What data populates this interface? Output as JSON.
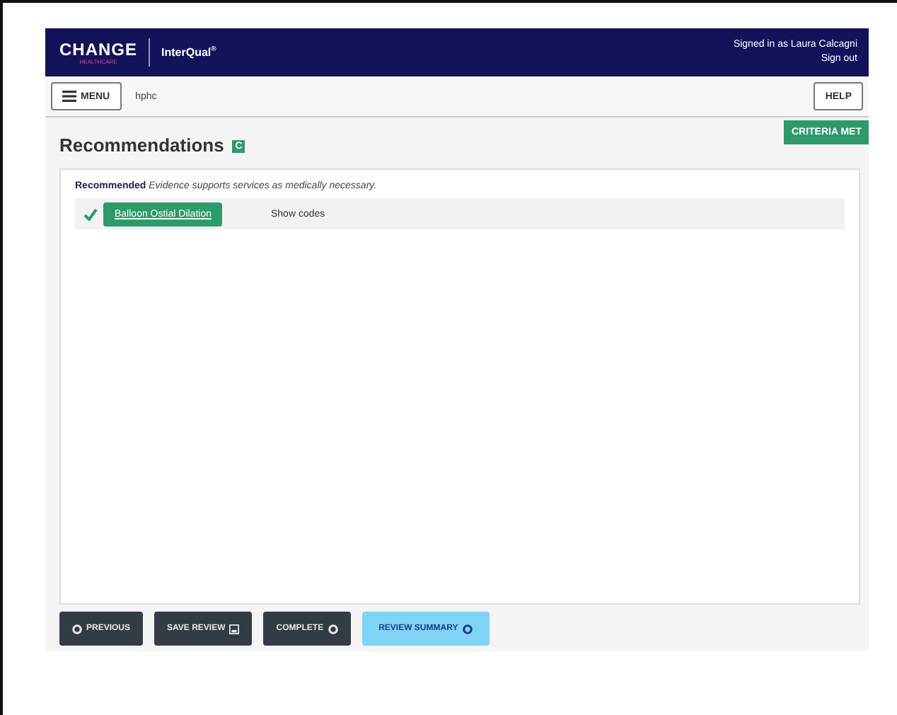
{
  "header": {
    "brand": "CHANGE",
    "brand_sub": "HEALTHCARE",
    "product": "InterQual",
    "product_mark": "®",
    "signed_in": "Signed in as Laura Calcagni",
    "sign_out": "Sign out"
  },
  "toolbar": {
    "menu": "MENU",
    "context": "hphc",
    "help": "HELP"
  },
  "status": {
    "label": "CRITERIA MET"
  },
  "section": {
    "title": "Recommendations",
    "badge": "C"
  },
  "recommendation": {
    "label": "Recommended",
    "description": "Evidence supports services as medically necessary."
  },
  "items": [
    {
      "name": "Balloon Ostial Dilation",
      "checked": true,
      "action": "Show codes"
    }
  ],
  "buttons": [
    {
      "label": "PREVIOUS",
      "kind": "prev"
    },
    {
      "label": "SAVE REVIEW",
      "kind": "save"
    },
    {
      "label": "COMPLETE",
      "kind": "next"
    },
    {
      "label": "REVIEW SUMMARY",
      "kind": "summary"
    }
  ]
}
